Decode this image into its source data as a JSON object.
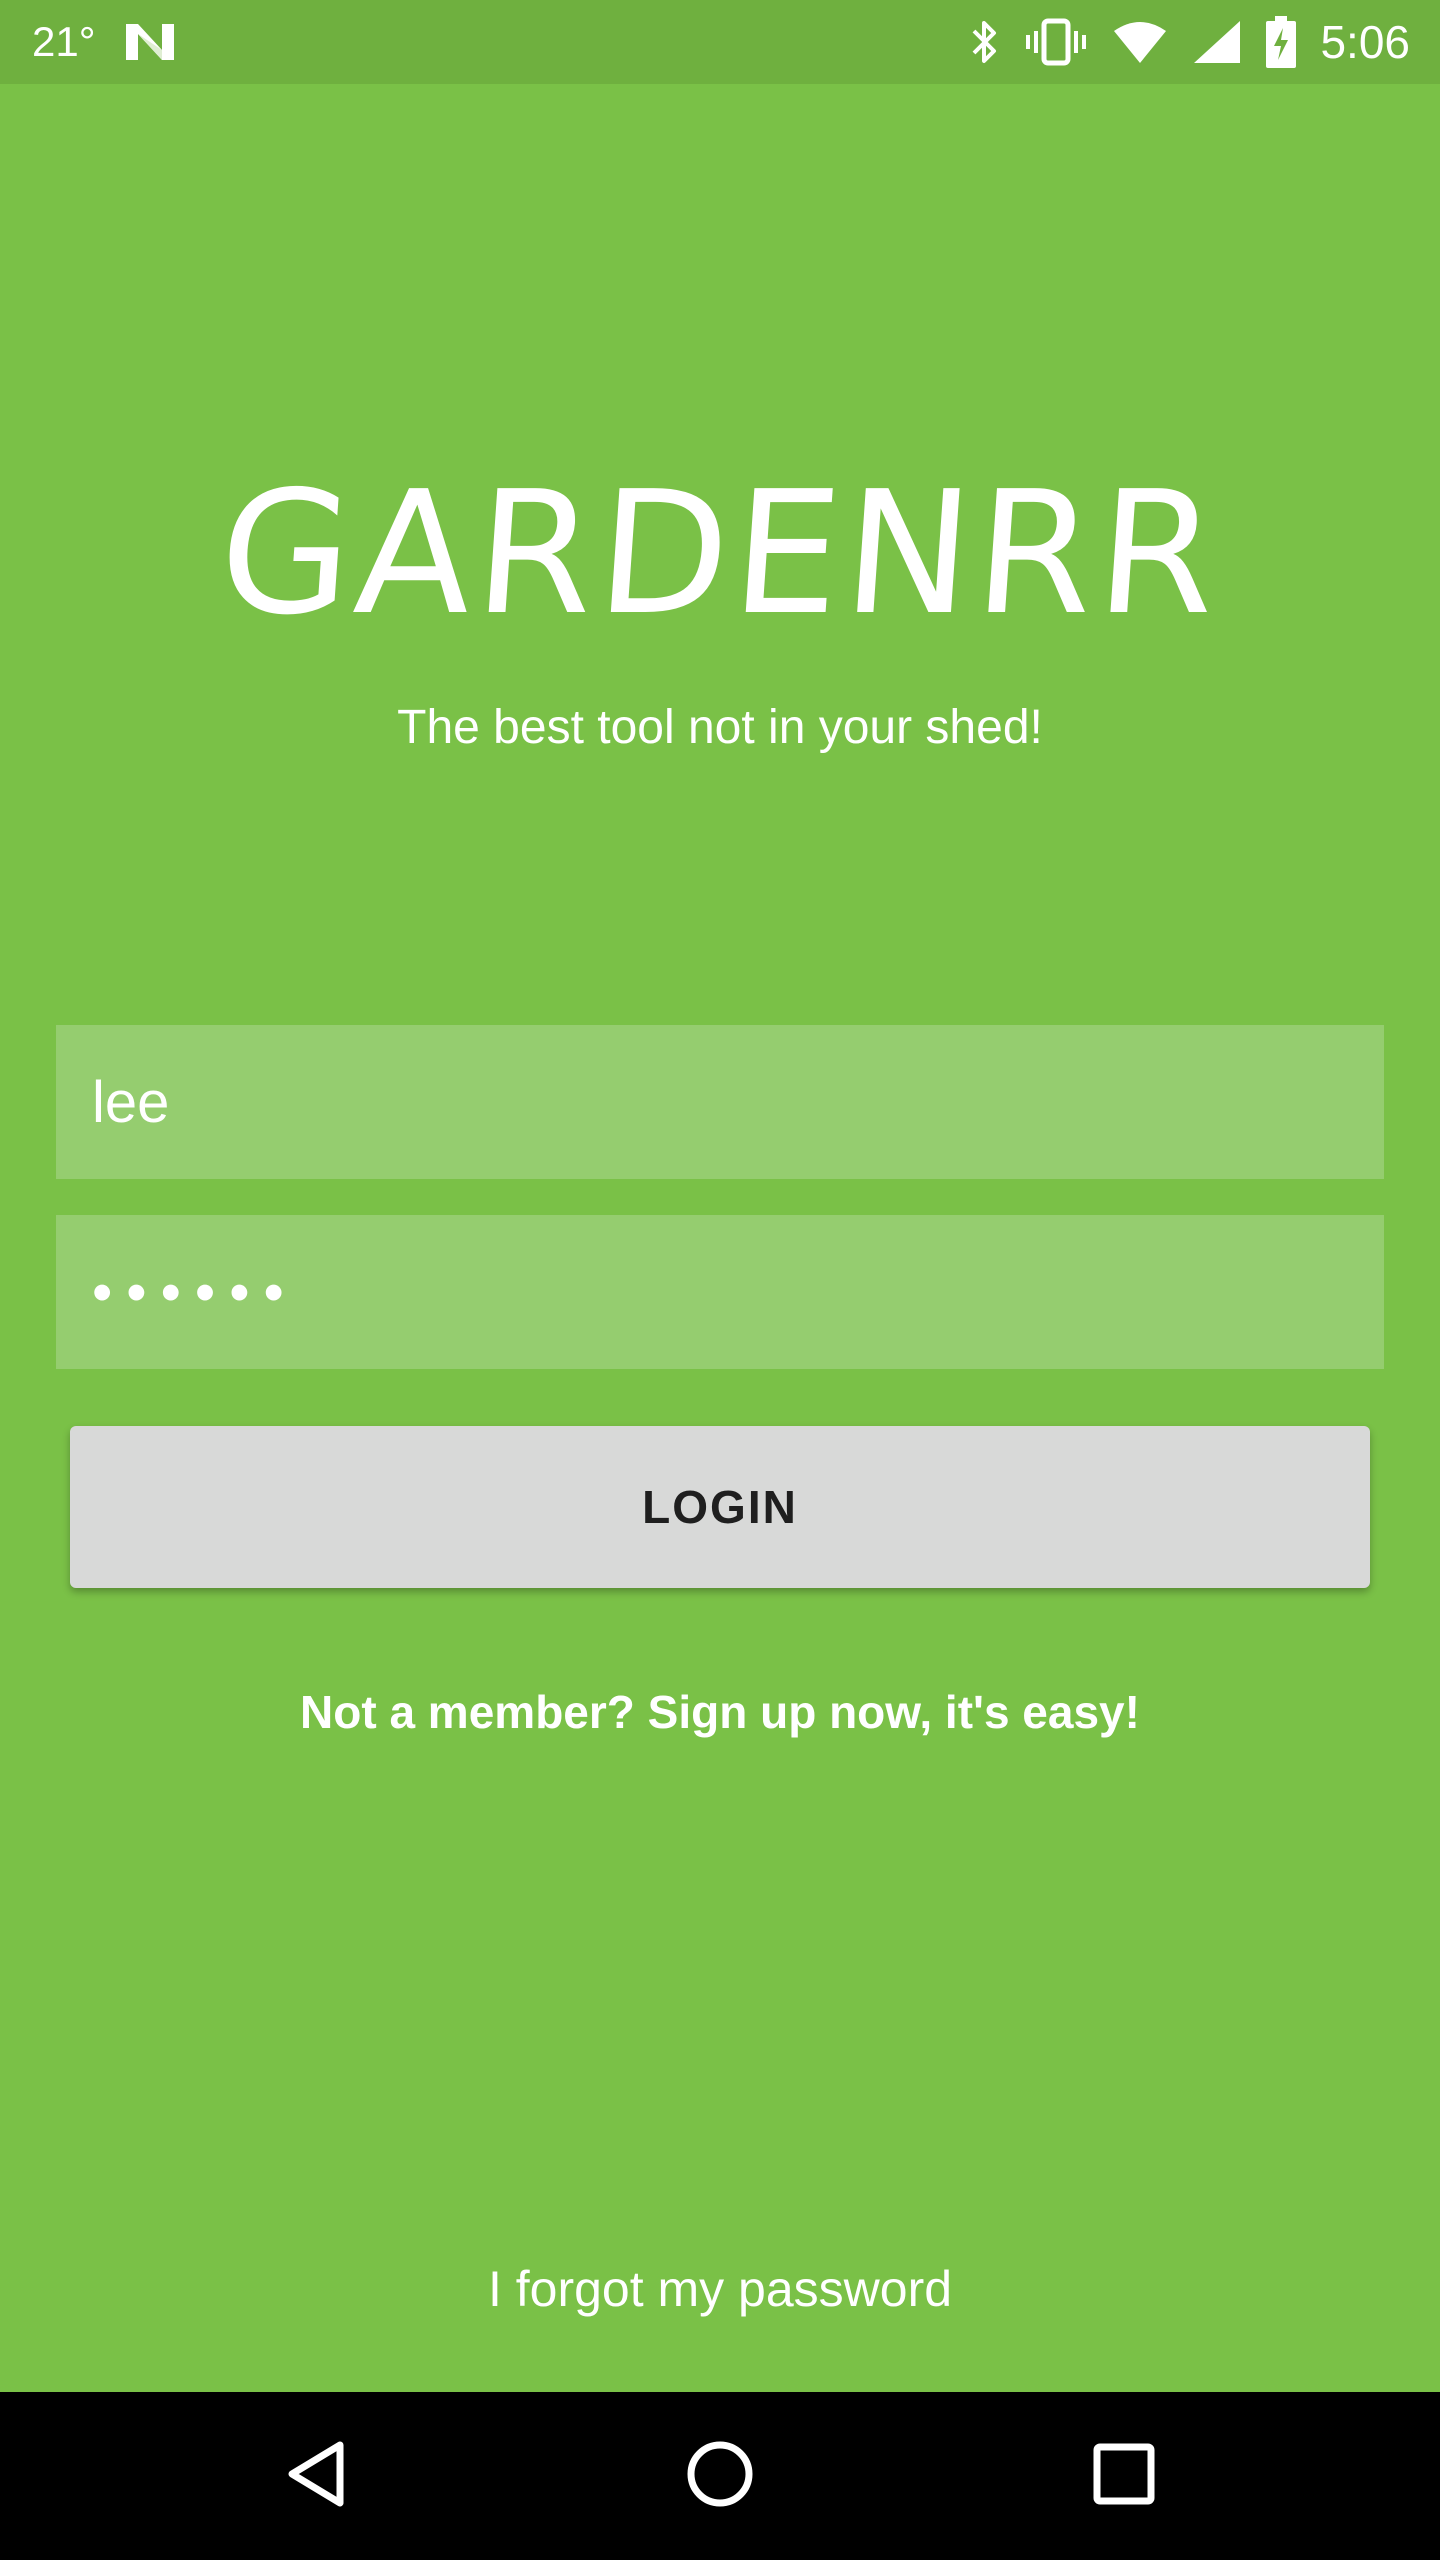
{
  "status_bar": {
    "temperature": "21°",
    "time": "5:06",
    "icons": [
      "notification-n-icon",
      "bluetooth-icon",
      "vibrate-icon",
      "wifi-icon",
      "signal-icon",
      "battery-charging-icon"
    ]
  },
  "app": {
    "logo": "GARDENRR",
    "tagline": "The best tool not in your shed!"
  },
  "form": {
    "username_value": "lee",
    "password_value": "••••••",
    "login_label": "LOGIN"
  },
  "links": {
    "signup": "Not a member? Sign up now, it's easy!",
    "forgot": "I forgot my password"
  },
  "nav": {
    "icons": [
      "back-icon",
      "home-icon",
      "recents-icon"
    ]
  },
  "colors": {
    "background": "#7ac147",
    "status_bar": "#6fb03f",
    "input_bg": "#95cd6f",
    "button_bg": "#d8d9d8",
    "nav_bar": "#000000"
  }
}
